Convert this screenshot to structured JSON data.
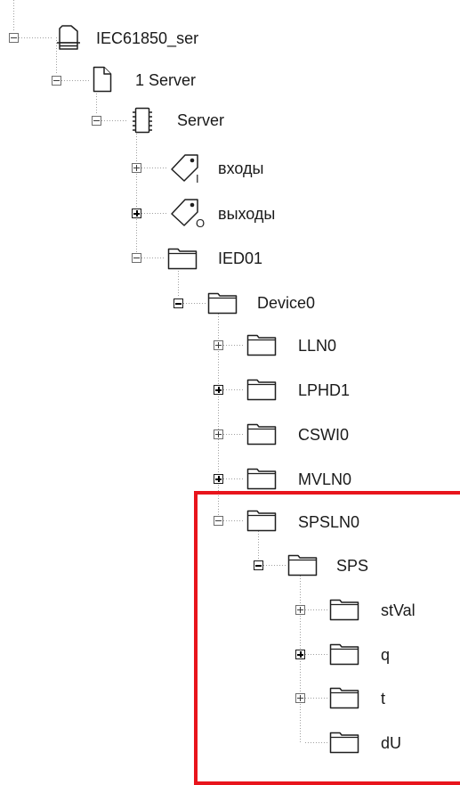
{
  "highlight_color": "#e8141c",
  "tree": [
    {
      "key": "iec",
      "label": "IEC61850_ser",
      "icon": "database-icon",
      "toggle": "minus"
    },
    {
      "key": "server1",
      "label": "1 Server",
      "icon": "document-icon",
      "toggle": "minus"
    },
    {
      "key": "server",
      "label": "Server",
      "icon": "chip-icon",
      "toggle": "minus"
    },
    {
      "key": "inputs",
      "label": "входы",
      "icon": "tag-input-icon",
      "tag_letter": "I",
      "toggle": "plus"
    },
    {
      "key": "outputs",
      "label": "выходы",
      "icon": "tag-output-icon",
      "tag_letter": "O",
      "toggle": "plus-bold"
    },
    {
      "key": "ied01",
      "label": "IED01",
      "icon": "folder-icon",
      "toggle": "minus"
    },
    {
      "key": "device0",
      "label": "Device0",
      "icon": "folder-icon",
      "toggle": "minus-bold"
    },
    {
      "key": "lln0",
      "label": "LLN0",
      "icon": "folder-icon",
      "toggle": "plus"
    },
    {
      "key": "lphd1",
      "label": "LPHD1",
      "icon": "folder-icon",
      "toggle": "plus-bold"
    },
    {
      "key": "cswi0",
      "label": "CSWI0",
      "icon": "folder-icon",
      "toggle": "plus"
    },
    {
      "key": "mvln0",
      "label": "MVLN0",
      "icon": "folder-icon",
      "toggle": "plus-bold"
    },
    {
      "key": "spsln0",
      "label": "SPSLN0",
      "icon": "folder-icon",
      "toggle": "minus"
    },
    {
      "key": "sps",
      "label": "SPS",
      "icon": "folder-icon",
      "toggle": "minus-bold"
    },
    {
      "key": "stval",
      "label": "stVal",
      "icon": "folder-icon",
      "toggle": "plus"
    },
    {
      "key": "q",
      "label": "q",
      "icon": "folder-icon",
      "toggle": "plus-bold"
    },
    {
      "key": "t",
      "label": "t",
      "icon": "folder-icon",
      "toggle": "plus"
    },
    {
      "key": "du",
      "label": "dU",
      "icon": "folder-icon",
      "toggle": "none"
    }
  ]
}
